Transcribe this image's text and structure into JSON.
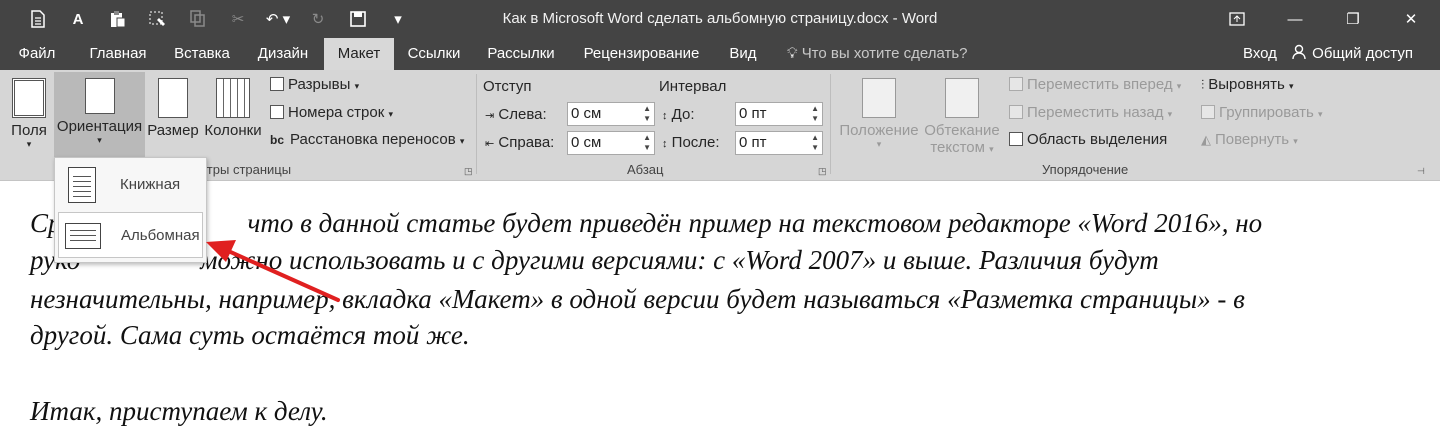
{
  "window": {
    "title": "Как в Microsoft Word сделать альбомную страницу.docx - Word"
  },
  "quick_access": {
    "icons": [
      "save-icon",
      "font-icon",
      "paste-icon",
      "format-painter-icon",
      "copy-icon",
      "cut-icon",
      "undo-icon",
      "redo-icon",
      "save-disk-icon",
      "customize-icon"
    ],
    "font_glyph": "A"
  },
  "tabs": [
    {
      "label": "Файл"
    },
    {
      "label": "Главная"
    },
    {
      "label": "Вставка"
    },
    {
      "label": "Дизайн"
    },
    {
      "label": "Макет",
      "active": true
    },
    {
      "label": "Ссылки"
    },
    {
      "label": "Рассылки"
    },
    {
      "label": "Рецензирование"
    },
    {
      "label": "Вид"
    }
  ],
  "tell_me": "Что вы хотите сделать?",
  "sign_in": "Вход",
  "share": "Общий доступ",
  "ribbon": {
    "page_setup": {
      "margins": "Поля",
      "orientation": "Ориентация",
      "size": "Размер",
      "columns": "Колонки",
      "breaks": "Разрывы",
      "line_numbers": "Номера строк",
      "hyphenation": "Расстановка переносов",
      "group_label": "Параметры страницы",
      "group_label_visible": "етры страницы"
    },
    "paragraph": {
      "indent_label": "Отступ",
      "spacing_label": "Интервал",
      "left_label": "Слева:",
      "left_value": "0 см",
      "right_label": "Справа:",
      "right_value": "0 см",
      "before_label": "До:",
      "before_value": "0 пт",
      "after_label": "После:",
      "after_value": "0 пт",
      "group_label": "Абзац"
    },
    "arrange": {
      "position": "Положение",
      "wrap_text_1": "Обтекание",
      "wrap_text_2": "текстом",
      "bring_forward": "Переместить вперед",
      "send_backward": "Переместить назад",
      "selection_pane": "Область выделения",
      "align": "Выровнять",
      "group": "Группировать",
      "rotate": "Повернуть",
      "group_label": "Упорядочение"
    }
  },
  "orientation_menu": {
    "portrait": "Книжная",
    "landscape": "Альбомная"
  },
  "document": {
    "line1_prefix": "Ср",
    "line1_rest": "что в данной статье будет приведён пример на текстовом редакторе «Word 2016», но",
    "line2_prefix": "руко",
    "line2_rest": "можно использовать и с другими версиями: с «Word 2007» и выше. Различия будут",
    "line3": "незначительны, например, вкладка «Макет» в одной версии будет называться «Разметка страницы» - в",
    "line4": "другой. Сама суть остаётся той же.",
    "line5": "Итак, приступаем к делу."
  },
  "colors": {
    "titlebar": "#444444",
    "ribbon": "#d6d6d6",
    "active_tab": "#d8d8d8",
    "arrow": "#e02020"
  }
}
